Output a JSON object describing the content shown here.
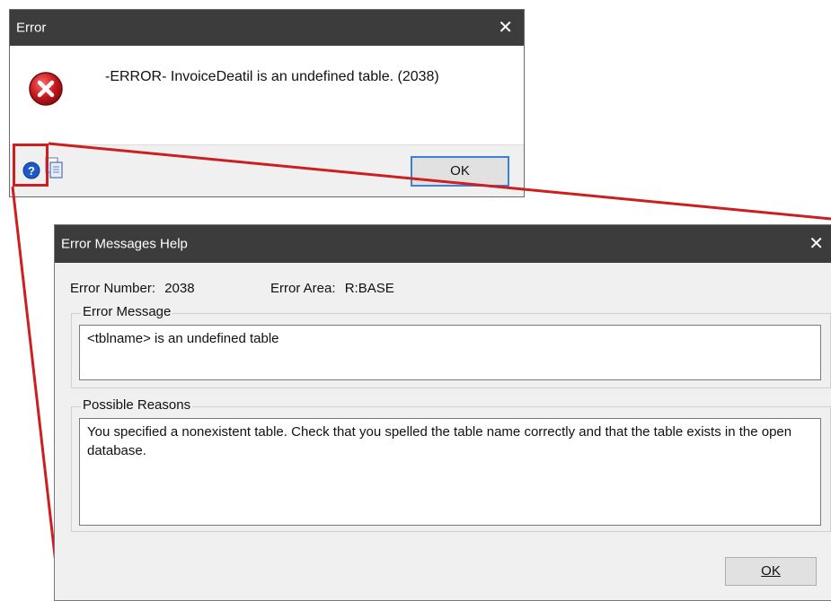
{
  "error_dialog": {
    "title": "Error",
    "close_glyph": "✕",
    "message": "-ERROR- InvoiceDeatil is an undefined table. (2038)",
    "ok_label": "OK",
    "icons": [
      "error-icon",
      "help-icon",
      "copy-icon"
    ]
  },
  "help_dialog": {
    "title": "Error Messages Help",
    "close_glyph": "✕",
    "error_number_label": "Error Number:",
    "error_number": "2038",
    "error_area_label": "Error Area:",
    "error_area": "R:BASE",
    "error_message_group": "Error Message",
    "error_message_text": "<tblname> is an undefined table",
    "possible_reasons_group": "Possible Reasons",
    "possible_reasons_text": "You specified a nonexistent table. Check that you spelled the table name correctly and that the table exists in the open database.",
    "ok_label": "OK"
  },
  "colors": {
    "titlebar": "#3c3c3c",
    "highlight_red": "#cc1f1f",
    "focus_blue": "#3b82d6"
  }
}
